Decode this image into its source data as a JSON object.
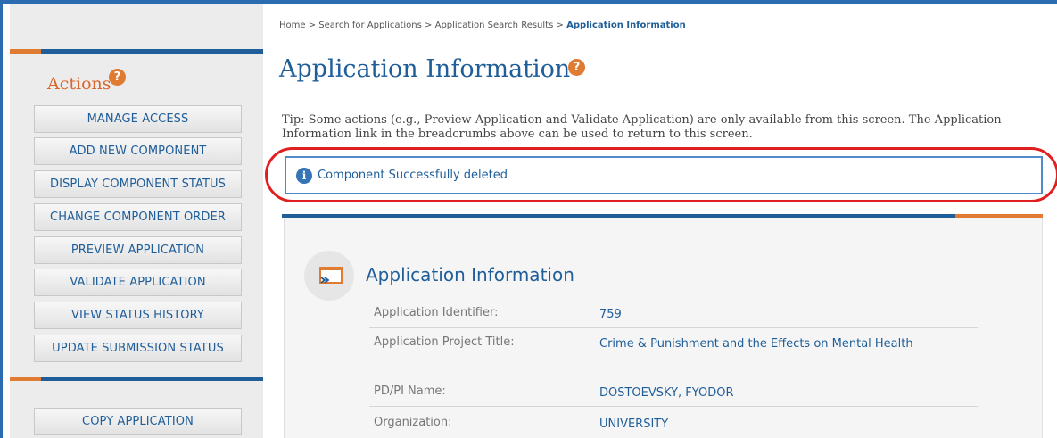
{
  "sidebar": {
    "title": "Actions",
    "help_symbol": "?",
    "buttons": [
      "MANAGE ACCESS",
      "ADD NEW COMPONENT",
      "DISPLAY COMPONENT STATUS",
      "CHANGE COMPONENT ORDER",
      "PREVIEW APPLICATION",
      "VALIDATE APPLICATION",
      "VIEW STATUS HISTORY",
      "UPDATE SUBMISSION STATUS"
    ],
    "copy_button": "COPY APPLICATION"
  },
  "breadcrumb": {
    "items": [
      "Home",
      "Search for Applications",
      "Application Search Results"
    ],
    "separator": ">",
    "current": "Application Information"
  },
  "page": {
    "title": "Application Information",
    "help_symbol": "?",
    "tip": "Tip: Some actions (e.g., Preview Application and Validate Application) are only available from this screen. The Application Information link in the breadcrumbs above can be used to return to this screen."
  },
  "alert": {
    "icon": "info-icon",
    "icon_glyph": "i",
    "message": "Component Successfully deleted"
  },
  "panel": {
    "title": "Application Information",
    "rows": [
      {
        "label": "Application Identifier:",
        "value": "759"
      },
      {
        "label": "Application Project Title:",
        "value": "Crime & Punishment and the Effects on Mental Health"
      },
      {
        "label": "PD/PI Name:",
        "value": "DOSTOEVSKY, FYODOR"
      },
      {
        "label": "Organization:",
        "value": "UNIVERSITY"
      }
    ]
  },
  "colors": {
    "accent_blue": "#1f5e99",
    "accent_orange": "#e07b32",
    "highlight_red": "#e02020"
  }
}
